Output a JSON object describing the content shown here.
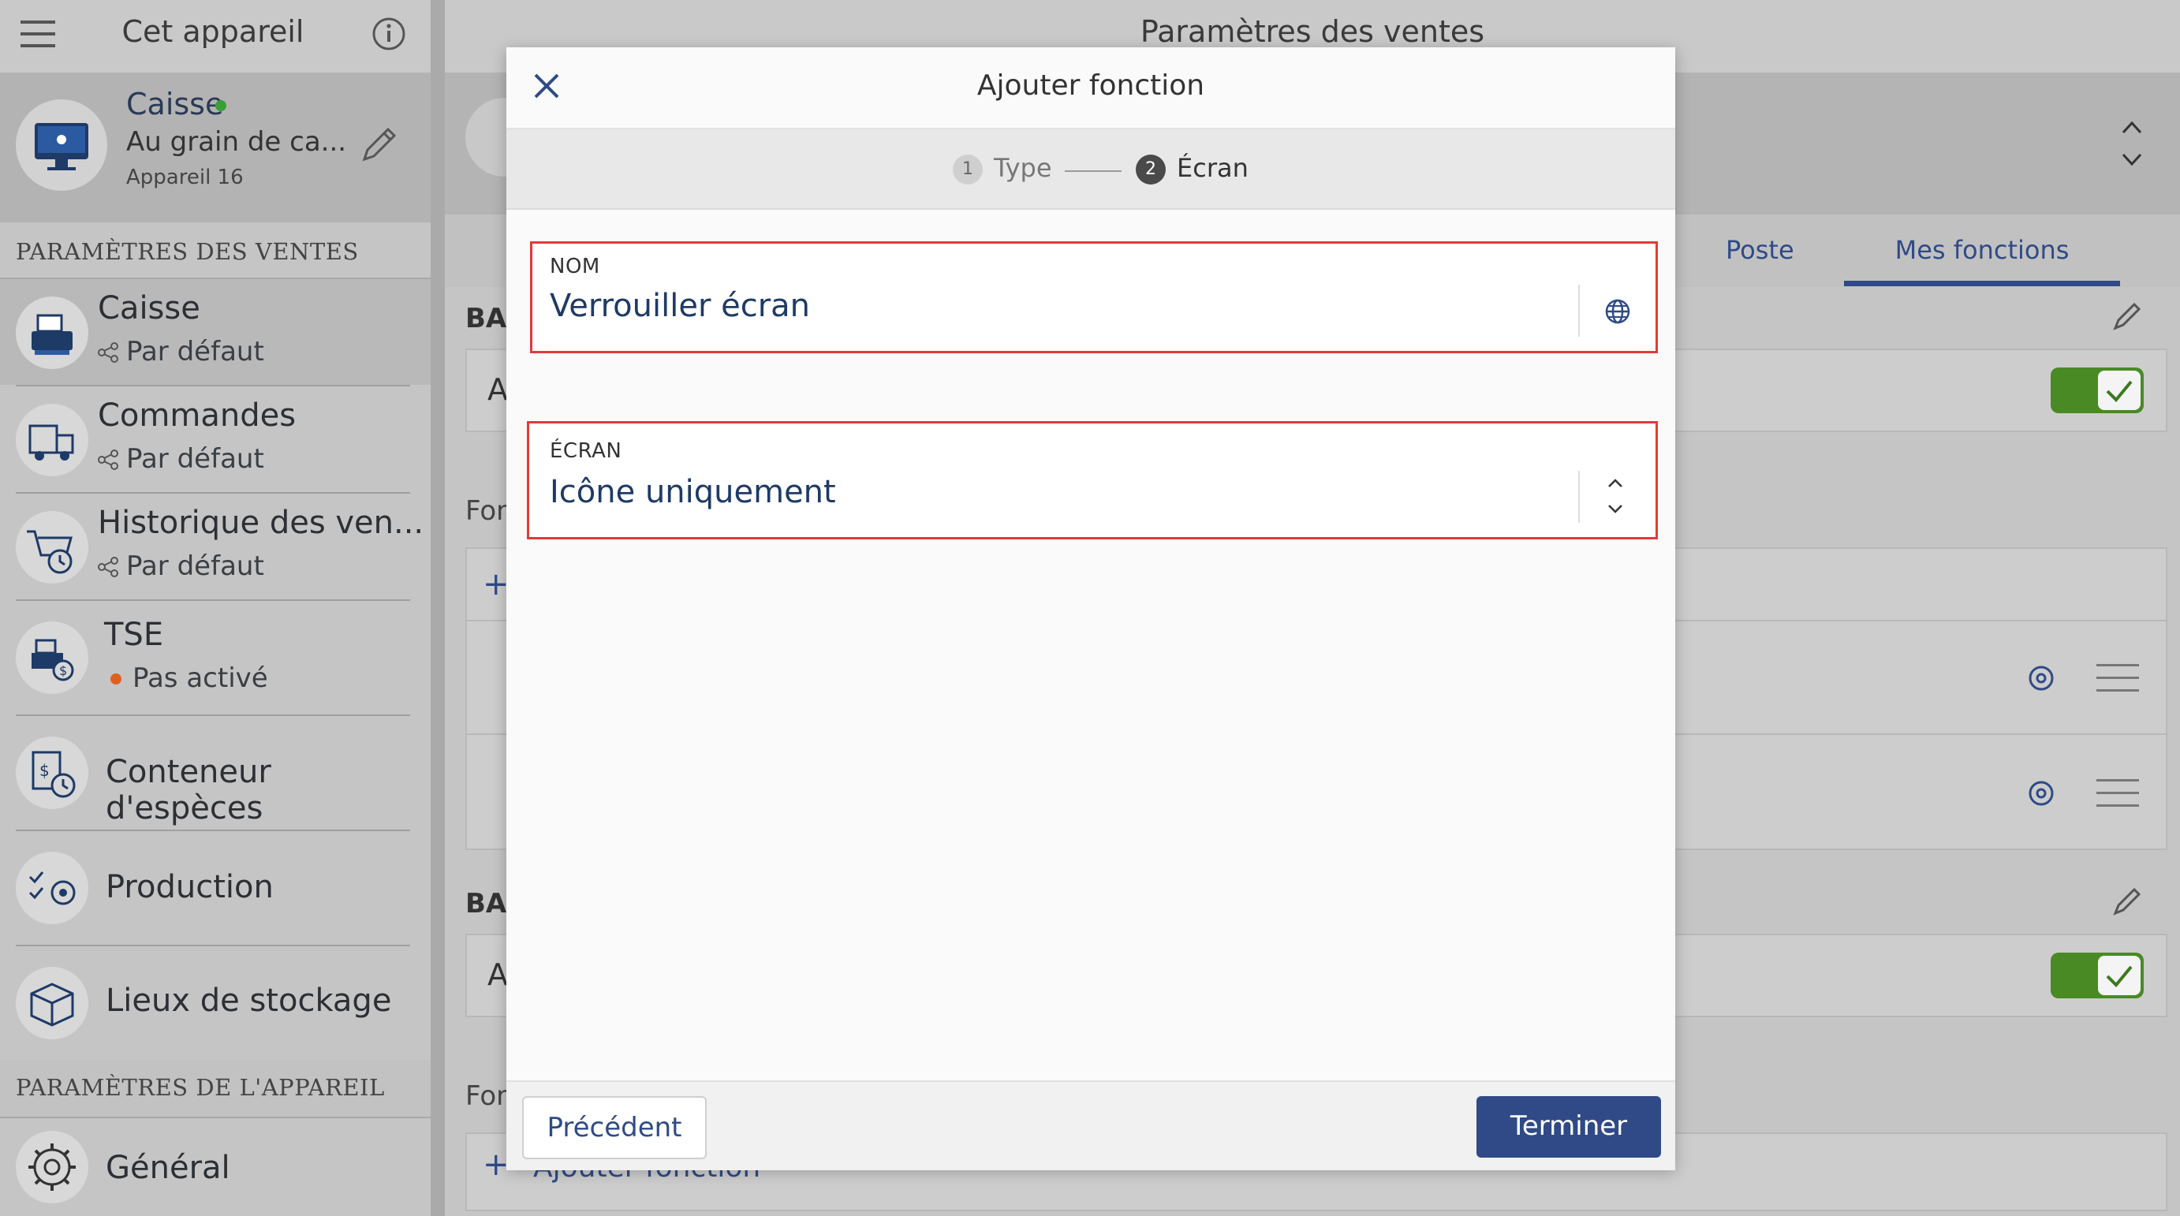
{
  "sidebar": {
    "header_title": "Cet appareil",
    "device": {
      "name": "Caisse",
      "description": "Au grain de ca...",
      "number": "Appareil 16",
      "status_color": "#3aa035"
    },
    "section_sales": "PARAMÈTRES DES VENTES",
    "items": [
      {
        "label": "Caisse",
        "sub": "Par défaut"
      },
      {
        "label": "Commandes",
        "sub": "Par défaut"
      },
      {
        "label": "Historique des ven...",
        "sub": "Par défaut"
      },
      {
        "label": "TSE",
        "sub": "Pas activé",
        "status_color": "#e0601e"
      },
      {
        "label": "Conteneur d'espèces"
      },
      {
        "label": "Production"
      },
      {
        "label": "Lieux de stockage"
      }
    ],
    "section_device": "PARAMÈTRES DE L'APPAREIL",
    "general": "Général"
  },
  "main": {
    "title": "Paramètres des ventes",
    "tabs": [
      "Poste",
      "Mes fonctions"
    ],
    "bg_labels": {
      "ba1": "BAI",
      "a1": "A",
      "fon1": "Fon",
      "ba2": "BAI",
      "a2": "A",
      "fon2": "Fon",
      "add_function": "Ajouter fonction"
    },
    "accent": "#2f4a86",
    "toggle_color": "#4a8a25"
  },
  "modal": {
    "title": "Ajouter fonction",
    "steps": [
      {
        "number": "1",
        "label": "Type"
      },
      {
        "number": "2",
        "label": "Écran"
      }
    ],
    "fields": {
      "name": {
        "label": "NOM",
        "value": "Verrouiller écran"
      },
      "screen": {
        "label": "ÉCRAN",
        "value": "Icône uniquement"
      }
    },
    "buttons": {
      "previous": "Précédent",
      "finish": "Terminer"
    },
    "highlight_color": "#e23a3a",
    "primary_color": "#2f4a86"
  }
}
